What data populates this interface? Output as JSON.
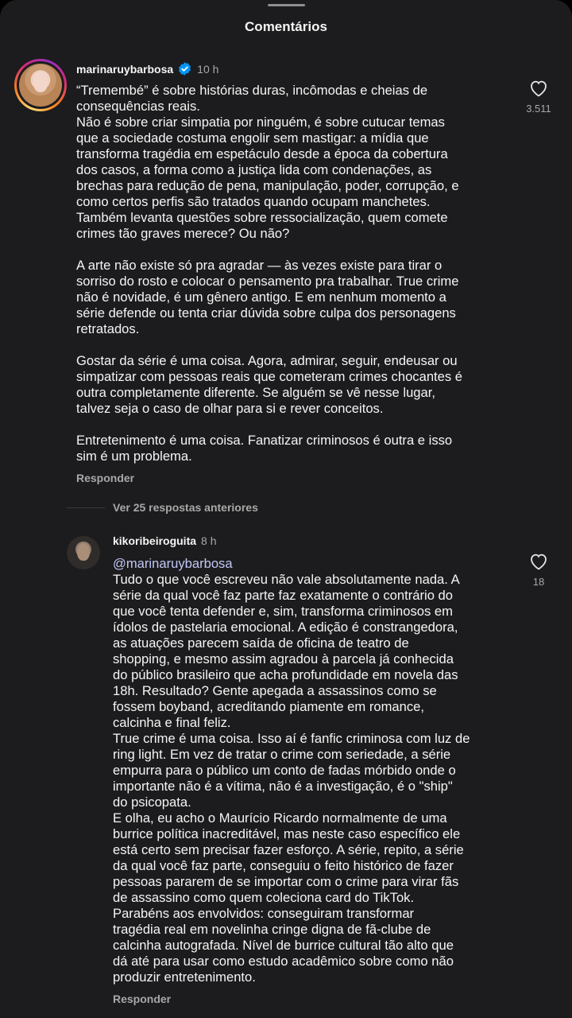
{
  "sheet": {
    "title": "Comentários"
  },
  "comment": {
    "username": "marinaruybarbosa",
    "time": "10 h",
    "likes": "3.511",
    "reply_label": "Responder",
    "lines": [
      "“Tremembé” é sobre histórias duras, incômodas e cheias de",
      "consequências reais.",
      "Não é sobre criar simpatia por ninguém, é sobre cutucar temas",
      "que a sociedade costuma engolir sem mastigar: a mídia que",
      "transforma tragédia em espetáculo desde a época da cobertura",
      "dos casos, a forma como a justiça lida com condenações, as",
      "brechas para redução de pena, manipulação, poder, corrupção, e",
      "como certos perfis são tratados quando ocupam manchetes.",
      "Também levanta questões sobre ressocialização, quem comete",
      "crimes tão graves merece? Ou não?",
      "",
      "A arte não existe só pra agradar — às vezes existe para tirar o",
      "sorriso do rosto e colocar o pensamento pra trabalhar. True crime",
      "não é novidade, é um gênero antigo. E em nenhum momento a",
      "série defende ou tenta criar dúvida sobre culpa dos personagens",
      "retratados.",
      "",
      "Gostar da série é uma coisa. Agora, admirar, seguir, endeusar ou",
      "simpatizar com pessoas reais que cometeram crimes chocantes é",
      "outra completamente diferente. Se alguém se vê nesse lugar,",
      "talvez seja o caso de olhar para si e rever conceitos.",
      "",
      "Entretenimento é uma coisa. Fanatizar criminosos é outra e isso",
      "sim é um problema."
    ]
  },
  "view_replies": "Ver 25 respostas anteriores",
  "reply": {
    "username": "kikoribeiroguita",
    "time": "8 h",
    "likes": "18",
    "mention": "@marinaruybarbosa",
    "reply_label": "Responder",
    "lines": [
      "Tudo o que você escreveu não vale absolutamente nada. A",
      "série da qual você faz parte faz exatamente o contrário do",
      "que você tenta defender e, sim, transforma criminosos em",
      "ídolos de pastelaria emocional. A edição é constrangedora,",
      "as atuações parecem saída de oficina de teatro de",
      "shopping, e mesmo assim agradou à parcela já conhecida",
      "do público brasileiro que acha profundidade em novela das",
      "18h. Resultado? Gente apegada a assassinos como se",
      "fossem boyband, acreditando piamente em romance,",
      "calcinha e final feliz.",
      "True crime é uma coisa. Isso aí é fanfic criminosa com luz de",
      "ring light. Em vez de tratar o crime com seriedade, a série",
      "empurra para o público um conto de fadas mórbido onde o",
      "importante não é a vítima, não é a investigação, é o \"ship\"",
      "do psicopata.",
      "E olha, eu acho o Maurício Ricardo normalmente de uma",
      "burrice política inacreditável, mas neste caso específico ele",
      "está certo sem precisar fazer esforço. A série, repito, a série",
      "da qual você faz parte, conseguiu o feito histórico de fazer",
      "pessoas pararem de se importar com o crime para virar fãs",
      "de assassino como quem coleciona card do TikTok.",
      "Parabéns aos envolvidos: conseguiram transformar",
      "tragédia real em novelinha cringe digna de fã-clube de",
      "calcinha autografada. Nível de burrice cultural tão alto que",
      "dá até para usar como estudo acadêmico sobre como não",
      "produzir entretenimento."
    ]
  },
  "icons": {
    "verified": "verified-badge-icon",
    "like": "heart-outline-icon"
  },
  "colors": {
    "sheet_bg": "#1c1c1e",
    "verified_blue": "#0095f6",
    "muted": "#a8a8a8",
    "mention": "#c1c7f5"
  }
}
